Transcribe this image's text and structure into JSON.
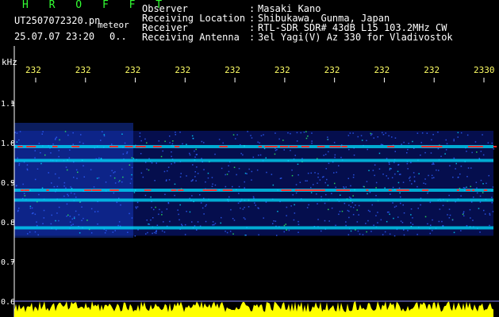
{
  "header": {
    "title": "H R O F F T",
    "file_name": "UT2507072320.pn",
    "tag": "meteor",
    "date_time": "25.07.07 23:20",
    "dots": "0..",
    "info": [
      {
        "label": "Observer",
        "value": "Masaki Kano"
      },
      {
        "label": "Receiving Location",
        "value": "Shibukawa, Gunma, Japan"
      },
      {
        "label": "Receiver",
        "value": "RTL-SDR SDR# 43dB L15 103.2MHz CW"
      },
      {
        "label": "Receiving Antenna",
        "value": "3el Yagi(V) Az 330 for Vladivostok"
      }
    ],
    "colon": ":"
  },
  "chart_data": {
    "type": "heatmap",
    "ylabel": "kHz",
    "y_ticks": [
      "1.1",
      "1.0",
      "0.9",
      "0.8",
      "0.7",
      "0.6"
    ],
    "ylim": [
      0.6,
      1.1
    ],
    "time_ticks": [
      "232",
      "232",
      "232",
      "232",
      "232",
      "232",
      "232",
      "232",
      "232",
      "2330"
    ],
    "grid": true,
    "signal_bands_khz": [
      0.99,
      0.955,
      0.88,
      0.855,
      0.785
    ],
    "colors": {
      "background": "#000000",
      "axis": "#ffffff",
      "tick_labels": "#ffff66",
      "noise_floor": "#0a1a8c",
      "band": "#00e0ff",
      "hot": "#ff3030",
      "amplitude": "#ffff00",
      "title": "#33ff33"
    }
  }
}
